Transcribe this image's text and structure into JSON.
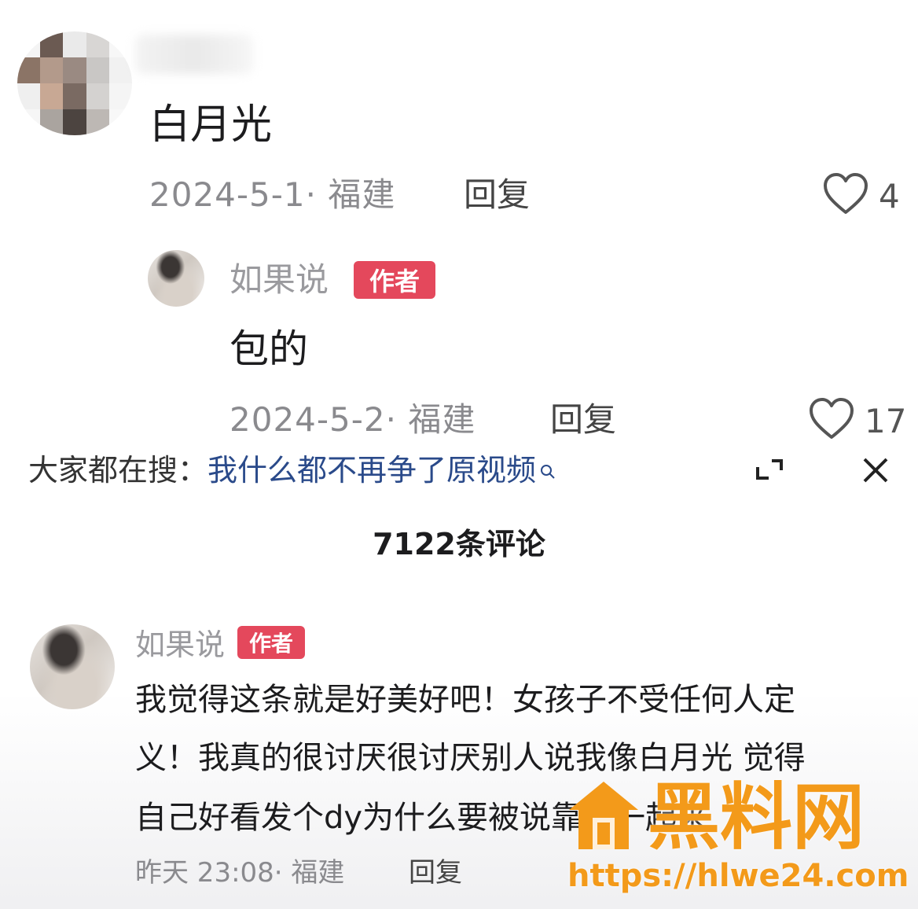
{
  "comment1": {
    "text": "白月光",
    "meta": "2024-5-1· 福建",
    "reply": "回复",
    "likes": "4"
  },
  "reply1": {
    "username": "如果说",
    "badge": "作者",
    "text": "包的",
    "meta": "2024-5-2· 福建",
    "reply": "回复",
    "likes": "17"
  },
  "search": {
    "label": "大家都在搜：",
    "query": "我什么都不再争了原视频"
  },
  "comments_count": "7122条评论",
  "comment2": {
    "username": "如果说",
    "badge": "作者",
    "text_line1": "我觉得这条就是好美好吧！女孩子不受任何人定",
    "text_line2": "义！我真的很讨厌很讨厌别人说我像白月光 觉得",
    "text_line3": "自己好看发个dy为什么要被说靠这一起来",
    "meta": "昨天 23:08· 福建",
    "reply": "回复"
  },
  "watermark": {
    "title": "黑料网",
    "url": "https://hlwe24.com"
  },
  "colors": {
    "badge": "#e4485c",
    "meta": "#8a8a8e",
    "link": "#2a4a8a",
    "watermark": "#f39a1a"
  }
}
